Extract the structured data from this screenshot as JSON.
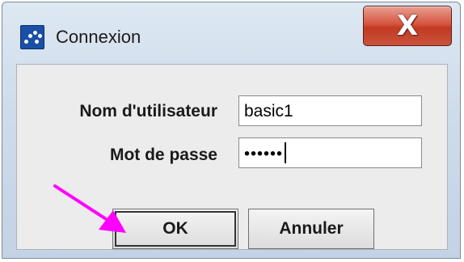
{
  "window": {
    "title": "Connexion",
    "close_label": "X"
  },
  "form": {
    "username_label": "Nom d'utilisateur",
    "username_value": "basic1",
    "password_label": "Mot de passe",
    "password_value": "••••••"
  },
  "buttons": {
    "ok_label": "OK",
    "cancel_label": "Annuler"
  },
  "colors": {
    "annotation_arrow": "#ff00ff",
    "close_button": "#c23a22",
    "app_icon": "#1a4fa8"
  }
}
